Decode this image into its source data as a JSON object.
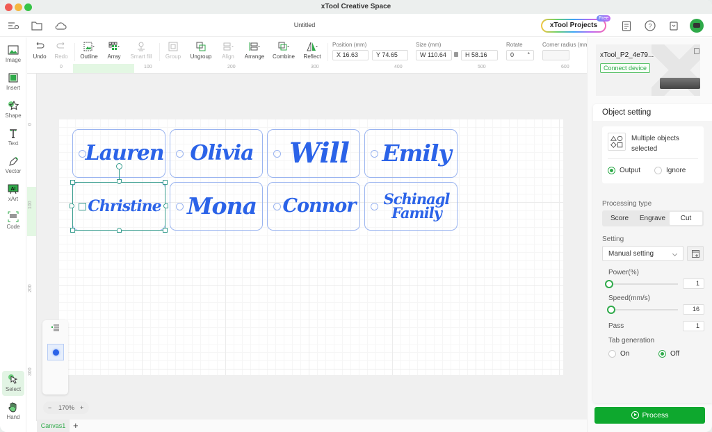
{
  "window": {
    "app_title": "xTool Creative Space"
  },
  "header": {
    "document_title": "Untitled",
    "projects_label": "xTool Projects",
    "free_badge": "Free",
    "icons": [
      "menu-settings-icon",
      "folder-icon",
      "cloud-icon",
      "clipboard-icon",
      "help-icon",
      "shop-bag-icon",
      "robot-avatar-icon"
    ]
  },
  "left_tools": [
    {
      "label": "Image",
      "icon": "image-icon"
    },
    {
      "label": "Insert",
      "icon": "insert-icon"
    },
    {
      "label": "Shape",
      "icon": "shape-icon"
    },
    {
      "label": "Text",
      "icon": "text-icon"
    },
    {
      "label": "Vector",
      "icon": "pen-icon"
    },
    {
      "label": "xArt",
      "icon": "ai-art-icon"
    },
    {
      "label": "Code",
      "icon": "barcode-icon"
    },
    {
      "label": "Select",
      "icon": "cursor-icon",
      "active": true
    },
    {
      "label": "Hand",
      "icon": "hand-icon"
    }
  ],
  "toolbar": {
    "buttons": [
      {
        "label": "Undo",
        "icon": "undo-icon",
        "enabled": true
      },
      {
        "label": "Redo",
        "icon": "redo-icon",
        "enabled": false
      },
      {
        "label": "Outline",
        "icon": "outline-icon",
        "enabled": true
      },
      {
        "label": "Array",
        "icon": "array-icon",
        "enabled": true
      },
      {
        "label": "Smart fill",
        "icon": "smart-fill-icon",
        "enabled": false
      },
      {
        "label": "Group",
        "icon": "group-icon",
        "enabled": false
      },
      {
        "label": "Ungroup",
        "icon": "ungroup-icon",
        "enabled": true
      },
      {
        "label": "Align",
        "icon": "align-icon",
        "enabled": false
      },
      {
        "label": "Arrange",
        "icon": "arrange-icon",
        "enabled": true
      },
      {
        "label": "Combine",
        "icon": "combine-icon",
        "enabled": true
      },
      {
        "label": "Reflect",
        "icon": "reflect-icon",
        "enabled": true
      }
    ],
    "position_label": "Position (mm)",
    "x_value": "X 16.63",
    "y_value": "Y 74.65",
    "size_label": "Size (mm)",
    "w_value": "W 110.64",
    "h_value": "H 58.16",
    "rotate_label": "Rotate",
    "rotate_value": "0",
    "rotate_unit": "°",
    "corner_label": "Corner radius (mm)",
    "corner_value": ""
  },
  "rulers": {
    "top": [
      "0",
      "100",
      "200",
      "300",
      "400",
      "500",
      "600"
    ],
    "left": [
      "0",
      "100",
      "200",
      "300"
    ]
  },
  "canvas": {
    "tags": [
      {
        "name": "Lauren"
      },
      {
        "name": "Olivia"
      },
      {
        "name": "Will"
      },
      {
        "name": "Emily"
      },
      {
        "name": "Christine",
        "selected": true
      },
      {
        "name": "Mona"
      },
      {
        "name": "Connor"
      },
      {
        "name": "Schinagl Family"
      }
    ]
  },
  "bottom": {
    "zoom_minus": "−",
    "zoom_level": "170%",
    "zoom_plus": "+",
    "canvas_tab": "Canvas1",
    "add_tab": "+"
  },
  "right_panel": {
    "device_name": "xTool_P2_4e79...",
    "connect_label": "Connect device",
    "object_setting_title": "Object setting",
    "multi_selected_text": "Multiple objects selected",
    "output_label": "Output",
    "ignore_label": "Ignore",
    "output_selected": "Output",
    "processing_type_label": "Processing type",
    "processing_types": [
      "Score",
      "Engrave",
      "Cut"
    ],
    "processing_type_selected": "Cut",
    "setting_label": "Setting",
    "setting_value": "Manual setting",
    "power_label": "Power(%)",
    "power_value": "1",
    "power_fraction": 0.01,
    "speed_label": "Speed(mm/s)",
    "speed_value": "16",
    "speed_fraction": 0.04,
    "pass_label": "Pass",
    "pass_value": "1",
    "tab_generation_label": "Tab generation",
    "tab_on_label": "On",
    "tab_off_label": "Off",
    "tab_selected": "Off",
    "process_label": "Process"
  },
  "colors": {
    "accent_green": "#2faa4a",
    "process_green": "#0ea82e",
    "tag_text_blue": "#2b63e8",
    "tag_outline": "#9ab4f0",
    "selection_teal": "#3a9d8f"
  }
}
